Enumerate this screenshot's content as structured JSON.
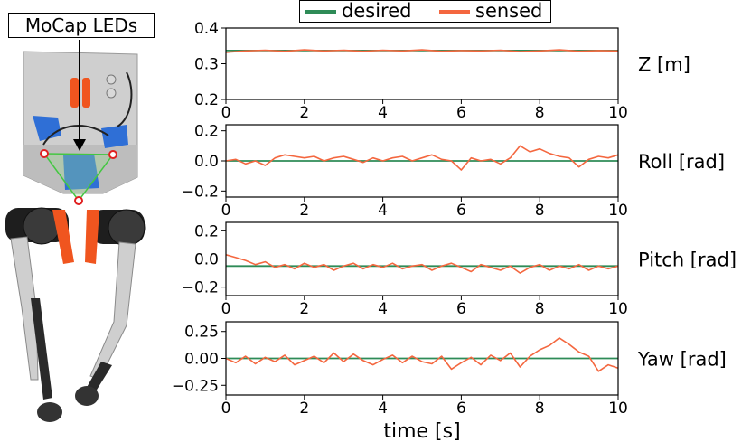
{
  "annotation": {
    "mocap_label": "MoCap LEDs"
  },
  "legend": [
    {
      "label": "desired",
      "color": "#2e8b57"
    },
    {
      "label": "sensed",
      "color": "#f4673f"
    }
  ],
  "colors": {
    "desired": "#2e8b57",
    "sensed": "#f4673f",
    "robot_body": "#cfcfcf",
    "robot_blue": "#2f6fd6",
    "robot_orange": "#f0551f",
    "robot_leg_dark": "#2a2a2a",
    "led_outline": "#44c742"
  },
  "chart_data": [
    {
      "type": "line",
      "panel_label": "Z [m]",
      "x_ticks": [
        "0",
        "2",
        "4",
        "6",
        "8",
        "10"
      ],
      "y_ticks": [
        "0.4",
        "0.3",
        "0.2"
      ],
      "y_tick_values": [
        0.4,
        0.3,
        0.2
      ],
      "xlim": [
        0,
        10
      ],
      "ylim": [
        0.2,
        0.4
      ],
      "series": [
        {
          "name": "desired",
          "x": [
            0,
            10
          ],
          "y": [
            0.337,
            0.337
          ]
        },
        {
          "name": "sensed",
          "x": [
            0,
            0.5,
            1,
            1.5,
            2,
            2.5,
            3,
            3.5,
            4,
            4.5,
            5,
            5.5,
            6,
            6.5,
            7,
            7.5,
            8,
            8.5,
            9,
            9.5,
            10
          ],
          "y": [
            0.332,
            0.336,
            0.338,
            0.335,
            0.339,
            0.336,
            0.338,
            0.335,
            0.338,
            0.336,
            0.339,
            0.335,
            0.337,
            0.336,
            0.338,
            0.334,
            0.336,
            0.339,
            0.335,
            0.337,
            0.336
          ]
        }
      ]
    },
    {
      "type": "line",
      "panel_label": "Roll [rad]",
      "x_ticks": [
        "0",
        "2",
        "4",
        "6",
        "8",
        "10"
      ],
      "y_ticks": [
        "0.2",
        "0.0",
        "−0.2"
      ],
      "y_tick_values": [
        0.2,
        0.0,
        -0.2
      ],
      "xlim": [
        0,
        10
      ],
      "ylim": [
        -0.24,
        0.24
      ],
      "series": [
        {
          "name": "desired",
          "x": [
            0,
            10
          ],
          "y": [
            0,
            0
          ]
        },
        {
          "name": "sensed",
          "x": [
            0,
            0.25,
            0.5,
            0.75,
            1,
            1.25,
            1.5,
            1.75,
            2,
            2.25,
            2.5,
            2.75,
            3,
            3.25,
            3.5,
            3.75,
            4,
            4.25,
            4.5,
            4.75,
            5,
            5.25,
            5.5,
            5.75,
            6,
            6.25,
            6.5,
            6.75,
            7,
            7.25,
            7.5,
            7.75,
            8,
            8.25,
            8.5,
            8.75,
            9,
            9.25,
            9.5,
            9.75,
            10
          ],
          "y": [
            0.0,
            0.01,
            -0.02,
            0.0,
            -0.03,
            0.02,
            0.04,
            0.03,
            0.02,
            0.03,
            0.0,
            0.02,
            0.03,
            0.01,
            -0.01,
            0.02,
            0.0,
            0.02,
            0.03,
            0.0,
            0.02,
            0.04,
            0.01,
            0.0,
            -0.06,
            0.02,
            0.0,
            0.01,
            -0.02,
            0.02,
            0.1,
            0.06,
            0.08,
            0.05,
            0.03,
            0.02,
            -0.04,
            0.01,
            0.03,
            0.02,
            0.04
          ]
        }
      ]
    },
    {
      "type": "line",
      "panel_label": "Pitch [rad]",
      "x_ticks": [
        "0",
        "2",
        "4",
        "6",
        "8",
        "10"
      ],
      "y_ticks": [
        "0.2",
        "0.0",
        "−0.2"
      ],
      "y_tick_values": [
        0.2,
        0.0,
        -0.2
      ],
      "xlim": [
        0,
        10
      ],
      "ylim": [
        -0.26,
        0.26
      ],
      "series": [
        {
          "name": "desired",
          "x": [
            0,
            10
          ],
          "y": [
            -0.05,
            -0.05
          ]
        },
        {
          "name": "sensed",
          "x": [
            0,
            0.25,
            0.5,
            0.75,
            1,
            1.25,
            1.5,
            1.75,
            2,
            2.25,
            2.5,
            2.75,
            3,
            3.25,
            3.5,
            3.75,
            4,
            4.25,
            4.5,
            4.75,
            5,
            5.25,
            5.5,
            5.75,
            6,
            6.25,
            6.5,
            6.75,
            7,
            7.25,
            7.5,
            7.75,
            8,
            8.25,
            8.5,
            8.75,
            9,
            9.25,
            9.5,
            9.75,
            10
          ],
          "y": [
            0.03,
            0.01,
            -0.01,
            -0.04,
            -0.02,
            -0.06,
            -0.04,
            -0.07,
            -0.03,
            -0.06,
            -0.04,
            -0.08,
            -0.05,
            -0.03,
            -0.07,
            -0.04,
            -0.06,
            -0.03,
            -0.07,
            -0.05,
            -0.04,
            -0.08,
            -0.05,
            -0.03,
            -0.06,
            -0.09,
            -0.04,
            -0.06,
            -0.08,
            -0.05,
            -0.1,
            -0.06,
            -0.04,
            -0.08,
            -0.05,
            -0.07,
            -0.04,
            -0.08,
            -0.05,
            -0.07,
            -0.05
          ]
        }
      ]
    },
    {
      "type": "line",
      "panel_label": "Yaw [rad]",
      "x_ticks": [
        "0",
        "2",
        "4",
        "6",
        "8",
        "10"
      ],
      "y_ticks": [
        "0.25",
        "0.00",
        "−0.25"
      ],
      "y_tick_values": [
        0.25,
        0.0,
        -0.25
      ],
      "xlim": [
        0,
        10
      ],
      "ylim": [
        -0.34,
        0.34
      ],
      "xlabel": "time [s]",
      "series": [
        {
          "name": "desired",
          "x": [
            0,
            10
          ],
          "y": [
            0,
            0
          ]
        },
        {
          "name": "sensed",
          "x": [
            0,
            0.25,
            0.5,
            0.75,
            1,
            1.25,
            1.5,
            1.75,
            2,
            2.25,
            2.5,
            2.75,
            3,
            3.25,
            3.5,
            3.75,
            4,
            4.25,
            4.5,
            4.75,
            5,
            5.25,
            5.5,
            5.75,
            6,
            6.25,
            6.5,
            6.75,
            7,
            7.25,
            7.5,
            7.75,
            8,
            8.25,
            8.5,
            8.75,
            9,
            9.25,
            9.5,
            9.75,
            10
          ],
          "y": [
            0.0,
            -0.04,
            0.02,
            -0.05,
            0.01,
            -0.03,
            0.03,
            -0.06,
            -0.02,
            0.02,
            -0.04,
            0.05,
            -0.03,
            0.04,
            -0.02,
            -0.06,
            -0.01,
            0.03,
            -0.04,
            0.02,
            -0.03,
            -0.05,
            0.02,
            -0.1,
            -0.04,
            0.01,
            -0.06,
            0.03,
            -0.02,
            0.05,
            -0.08,
            0.02,
            0.08,
            0.12,
            0.19,
            0.13,
            0.06,
            0.02,
            -0.12,
            -0.06,
            -0.09
          ]
        }
      ]
    }
  ]
}
